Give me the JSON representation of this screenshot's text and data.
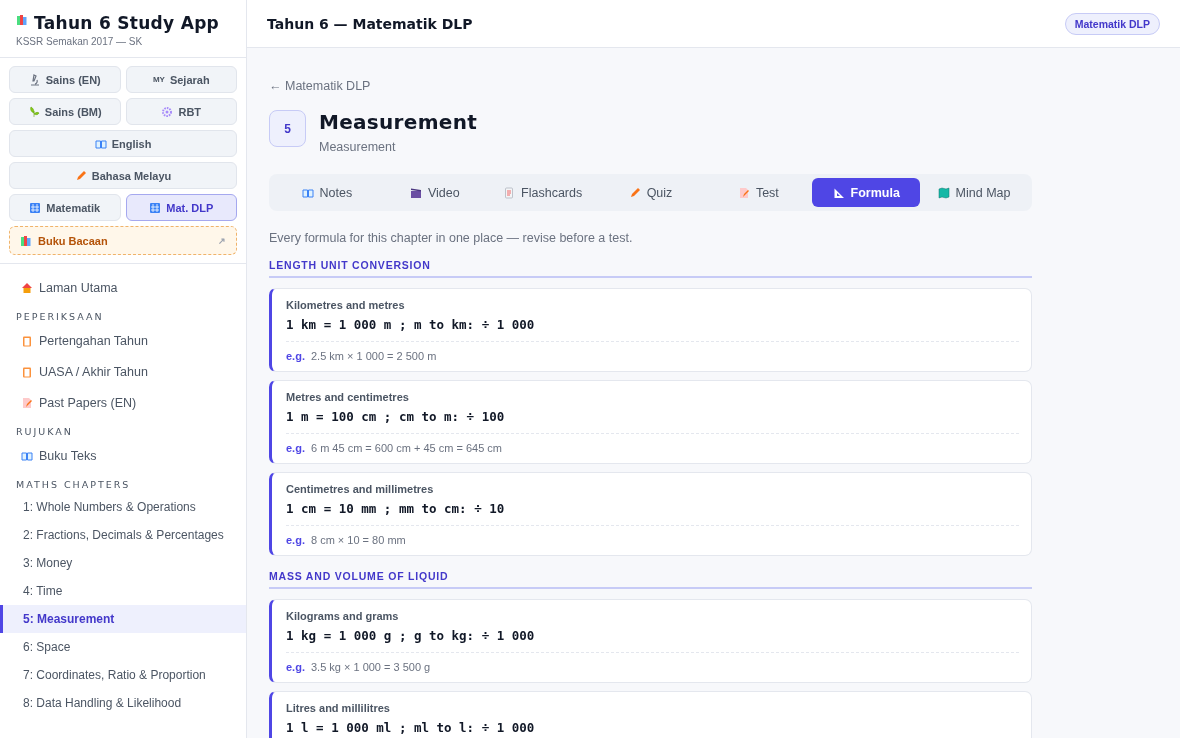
{
  "app": {
    "title": "Tahun 6 Study App",
    "subtitle": "KSSR Semakan 2017 — SK"
  },
  "subjects": [
    {
      "label": "Sains (EN)",
      "wide": false,
      "selected": false
    },
    {
      "label": "Sejarah",
      "badge": "MY",
      "wide": false,
      "selected": false
    },
    {
      "label": "Sains (BM)",
      "wide": false,
      "selected": false
    },
    {
      "label": "RBT",
      "wide": false,
      "selected": false
    },
    {
      "label": "English",
      "wide": true,
      "selected": false
    },
    {
      "label": "Bahasa Melayu",
      "wide": true,
      "selected": false
    },
    {
      "label": "Matematik",
      "wide": false,
      "selected": false
    },
    {
      "label": "Mat. DLP",
      "wide": false,
      "selected": true
    }
  ],
  "reading_link": {
    "label": "Buku Bacaan",
    "arrow": "↗"
  },
  "nav": [
    {
      "kind": "item",
      "label": "Laman Utama",
      "selected": false
    },
    {
      "kind": "heading",
      "label": "PEPERIKSAAN"
    },
    {
      "kind": "item",
      "label": "Pertengahan Tahun",
      "selected": false
    },
    {
      "kind": "item",
      "label": "UASA / Akhir Tahun",
      "selected": false
    },
    {
      "kind": "item",
      "label": "Past Papers (EN)",
      "selected": false
    },
    {
      "kind": "heading",
      "label": "RUJUKAN"
    },
    {
      "kind": "item",
      "label": "Buku Teks",
      "selected": false
    },
    {
      "kind": "heading",
      "label": "MATHS CHAPTERS"
    },
    {
      "kind": "chapter",
      "label": "1: Whole Numbers & Operations",
      "selected": false
    },
    {
      "kind": "chapter",
      "label": "2: Fractions, Decimals & Percentages",
      "selected": false
    },
    {
      "kind": "chapter",
      "label": "3: Money",
      "selected": false
    },
    {
      "kind": "chapter",
      "label": "4: Time",
      "selected": false
    },
    {
      "kind": "chapter",
      "label": "5: Measurement",
      "selected": true
    },
    {
      "kind": "chapter",
      "label": "6: Space",
      "selected": false
    },
    {
      "kind": "chapter",
      "label": "7: Coordinates, Ratio & Proportion",
      "selected": false
    },
    {
      "kind": "chapter",
      "label": "8: Data Handling & Likelihood",
      "selected": false
    }
  ],
  "header": {
    "title": "Tahun 6 — Matematik DLP",
    "badge": "Matematik DLP"
  },
  "back_link": "← Matematik DLP",
  "chapter": {
    "number": "5",
    "title": "Measurement",
    "subtitle": "Measurement"
  },
  "tabs": [
    {
      "label": "Notes",
      "selected": false
    },
    {
      "label": "Video",
      "selected": false
    },
    {
      "label": "Flashcards",
      "selected": false
    },
    {
      "label": "Quiz",
      "selected": false
    },
    {
      "label": "Test",
      "selected": false
    },
    {
      "label": "Formula",
      "selected": true
    },
    {
      "label": "Mind Map",
      "selected": false
    }
  ],
  "intro": "Every formula for this chapter in one place — revise before a test.",
  "sections": [
    {
      "title": "LENGTH UNIT CONVERSION",
      "formulas": [
        {
          "name": "Kilometres and metres",
          "formula": "1 km = 1 000 m ; m to km: ÷ 1 000",
          "eg_label": "e.g.",
          "example": "2.5 km × 1 000 = 2 500 m"
        },
        {
          "name": "Metres and centimetres",
          "formula": "1 m = 100 cm ; cm to m: ÷ 100",
          "eg_label": "e.g.",
          "example": "6 m 45 cm = 600 cm + 45 cm = 645 cm"
        },
        {
          "name": "Centimetres and millimetres",
          "formula": "1 cm = 10 mm ; mm to cm: ÷ 10",
          "eg_label": "e.g.",
          "example": "8 cm × 10 = 80 mm"
        }
      ]
    },
    {
      "title": "MASS AND VOLUME OF LIQUID",
      "formulas": [
        {
          "name": "Kilograms and grams",
          "formula": "1 kg = 1 000 g ; g to kg: ÷ 1 000",
          "eg_label": "e.g.",
          "example": "3.5 kg × 1 000 = 3 500 g"
        },
        {
          "name": "Litres and millilitres",
          "formula": "1 l = 1 000 ml ; ml to l: ÷ 1 000"
        }
      ]
    }
  ]
}
